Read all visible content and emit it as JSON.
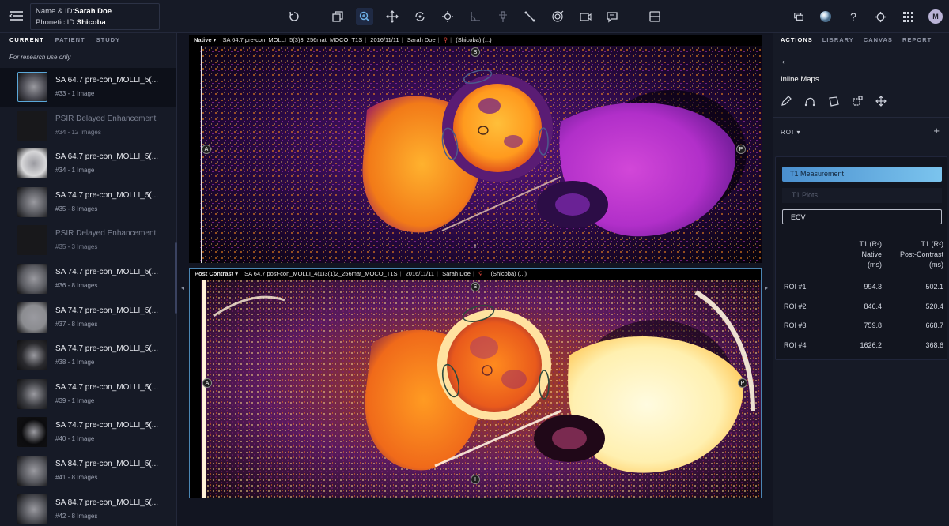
{
  "patient": {
    "name_label": "Name & ID:",
    "name_value": "Sarah Doe",
    "phonetic_label": "Phonetic ID:",
    "phonetic_value": "Shicoba"
  },
  "toolbar": {
    "icons": [
      "reset-icon",
      "layers-icon",
      "zoom-icon",
      "pan-icon",
      "rotate-icon",
      "window-level-icon",
      "angle-icon",
      "probe-icon",
      "length-icon",
      "roi-icon",
      "video-icon",
      "annotation-icon",
      "layout-icon"
    ]
  },
  "left_panel": {
    "tabs": [
      "CURRENT",
      "PATIENT",
      "STUDY"
    ],
    "note": "For research use only",
    "series": [
      {
        "title": "SA 64.7 pre-con_MOLLI_5(...",
        "sub": "#33 - 1 Image",
        "selected": true,
        "dim": false
      },
      {
        "title": "PSIR Delayed Enhancement",
        "sub": "#34 - 12 Images",
        "selected": false,
        "dim": true
      },
      {
        "title": "SA 64.7 pre-con_MOLLI_5(...",
        "sub": "#34 - 1 Image",
        "selected": false,
        "dim": false
      },
      {
        "title": "SA 74.7 pre-con_MOLLI_5(...",
        "sub": "#35 - 8 Images",
        "selected": false,
        "dim": false
      },
      {
        "title": "PSIR Delayed Enhancement",
        "sub": "#35 - 3 Images",
        "selected": false,
        "dim": true
      },
      {
        "title": "SA 74.7 pre-con_MOLLI_5(...",
        "sub": "#36 - 8 Images",
        "selected": false,
        "dim": false
      },
      {
        "title": "SA 74.7 pre-con_MOLLI_5(...",
        "sub": "#37 - 8 Images",
        "selected": false,
        "dim": false
      },
      {
        "title": "SA 74.7 pre-con_MOLLI_5(...",
        "sub": "#38 - 1 Image",
        "selected": false,
        "dim": false
      },
      {
        "title": "SA 74.7 pre-con_MOLLI_5(...",
        "sub": "#39 - 1 Image",
        "selected": false,
        "dim": false
      },
      {
        "title": "SA 74.7 pre-con_MOLLI_5(...",
        "sub": "#40 - 1 Image",
        "selected": false,
        "dim": false
      },
      {
        "title": "SA 84.7 pre-con_MOLLI_5(...",
        "sub": "#41 - 8 Images",
        "selected": false,
        "dim": false
      },
      {
        "title": "SA 84.7 pre-con_MOLLI_5(...",
        "sub": "#42 - 8 Images",
        "selected": false,
        "dim": false
      }
    ]
  },
  "viewport1": {
    "mode": "Native",
    "series": "SA 64.7 pre-con_MOLLI_5(3)3_256mat_MOCO_T1S",
    "date": "2016/11/11",
    "name": "Sarah Doe",
    "alias": "(Shicoba)",
    "more": "(...)",
    "orient": {
      "top": "S",
      "left": "A",
      "right": "P",
      "bottom": "I"
    }
  },
  "viewport2": {
    "mode": "Post Contrast",
    "series": "SA 64.7 post-con_MOLLI_4(1)3(1)2_256mat_MOCO_T1S",
    "date": "2016/11/11",
    "name": "Sarah Doe",
    "alias": "(Shicoba)",
    "more": "(...)",
    "orient": {
      "top": "S",
      "left": "A",
      "right": "P",
      "bottom": "I"
    }
  },
  "right_panel": {
    "tabs": [
      "ACTIONS",
      "LIBRARY",
      "CANVAS",
      "REPORT"
    ],
    "section_title": "Inline Maps",
    "roi_label": "ROI",
    "buttons": {
      "t1_measurement": "T1 Measurement",
      "t1_plots": "T1 Plots",
      "ecv": "ECV"
    },
    "table": {
      "headers": {
        "native_1": "T1 (R²)",
        "native_2": "Native",
        "native_3": "(ms)",
        "post_1": "T1 (R²)",
        "post_2": "Post-Contrast",
        "post_3": "(ms)"
      },
      "rows": [
        {
          "label": "ROI #1",
          "native": "994.3",
          "post": "502.1"
        },
        {
          "label": "ROI #2",
          "native": "846.4",
          "post": "520.4"
        },
        {
          "label": "ROI #3",
          "native": "759.8",
          "post": "668.7"
        },
        {
          "label": "ROI #4",
          "native": "1626.2",
          "post": "368.6"
        }
      ]
    }
  },
  "user": {
    "avatar_initial": "M"
  }
}
